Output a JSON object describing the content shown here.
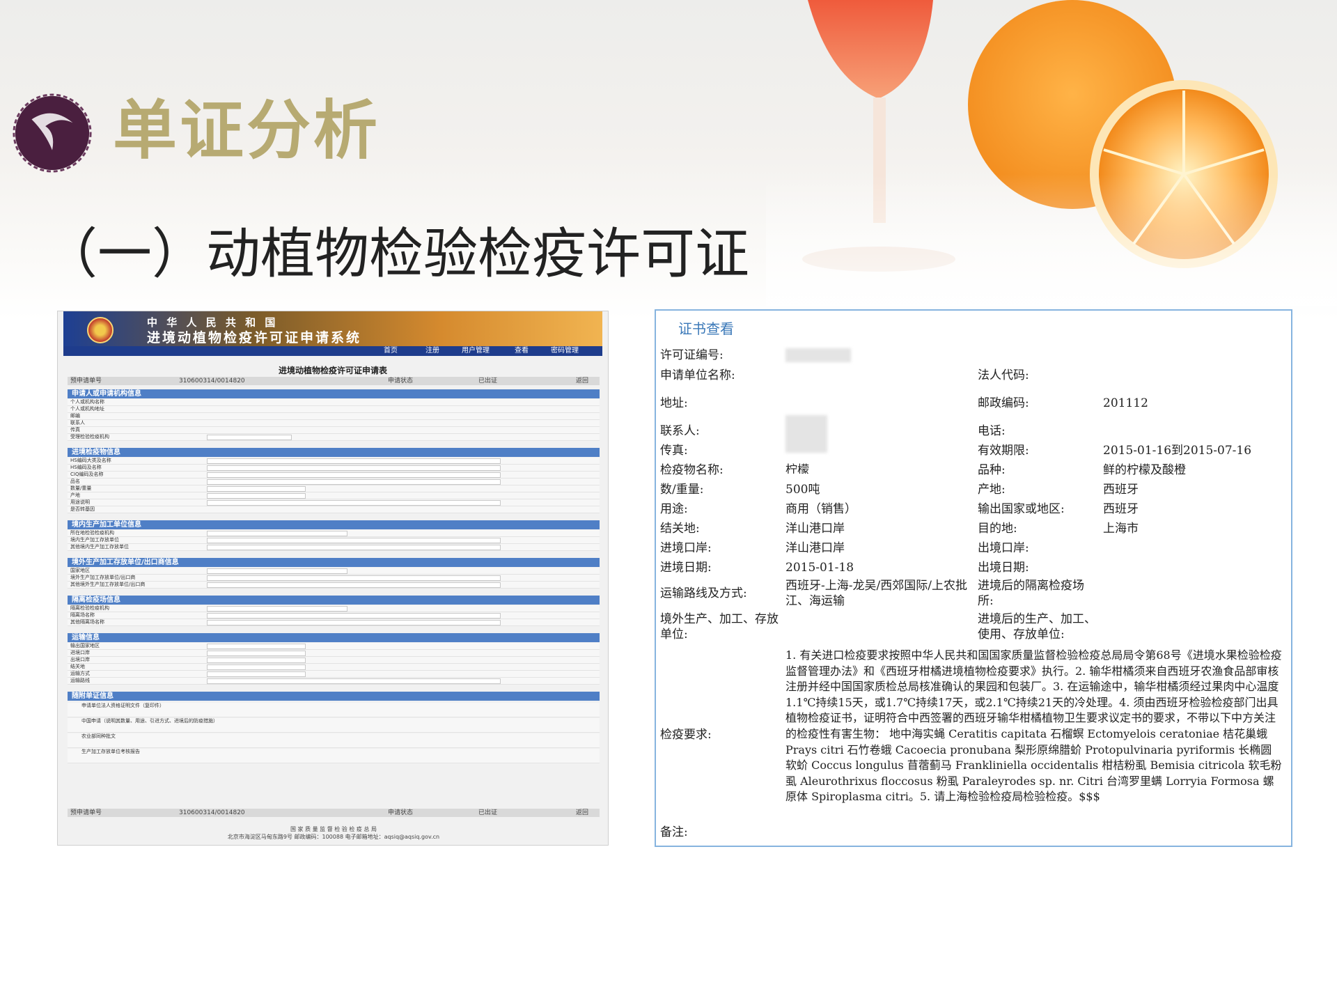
{
  "page": {
    "section_title": "单证分析",
    "subtitle": "（一）动植物检验检疫许可证"
  },
  "app": {
    "title_line1": "中 华 人 民 共 和 国",
    "title_line2": "进境动植物检疫许可证申请系统",
    "nav": [
      "首页",
      "注册",
      "用户管理",
      "查看",
      "密码管理"
    ],
    "form_title": "进境动植物检疫许可证申请表",
    "top_bar": {
      "label": "预申请单号",
      "number": "310600314/0014820",
      "status_label": "申请状态",
      "status": "已出证",
      "button": "返回"
    },
    "sections": [
      {
        "title": "申请人或申请机构信息",
        "rows": [
          "个人或机构名称",
          "个人或机构地址",
          "邮编",
          "联系人",
          "传真",
          "受理检验检疫机构"
        ]
      },
      {
        "title": "进境检疫物信息",
        "rows": [
          "HS编码大类及名称",
          "HS编码及名称",
          "CIQ编码及名称",
          "品名",
          "数量/重量",
          "产地",
          "用途说明",
          "是否转基因"
        ]
      },
      {
        "title": "境内生产加工单位信息",
        "rows": [
          "所在地检验检疫机构",
          "境内生产加工存放单位",
          "其他境内生产加工存放单位"
        ]
      },
      {
        "title": "境外生产加工存放单位/出口商信息",
        "rows": [
          "国家地区",
          "境外生产加工存放单位/出口商",
          "其他境外生产加工存放单位/出口商"
        ]
      },
      {
        "title": "隔离检疫场信息",
        "rows": [
          "隔离检验检疫机构",
          "隔离场名称",
          "其他隔离场名称"
        ]
      },
      {
        "title": "运输信息",
        "rows": [
          "输出国家地区",
          "进境口岸",
          "出境口岸",
          "结关地",
          "运输方式",
          "运输路线"
        ]
      },
      {
        "title": "随附单证信息",
        "rows": [
          "申请单位法人资格证明文件（复印件）",
          "中国申请（说明其数量、用途、引进方式、进境后的防疫措施）",
          "农业部同种批文",
          "生产加工存放单位考核报告"
        ]
      }
    ],
    "bottom_bar": {
      "label": "预申请单号",
      "number": "310600314/0014820",
      "status_label": "申请状态",
      "status": "已出证",
      "button": "返回"
    },
    "footer_line1": "国 家 质 量 监 督 检 验 检 疫 总 局",
    "footer_line2": "北京市海淀区马甸东路9号  邮政编码：100088  电子邮箱地址：aqsiq@aqsiq.gov.cn"
  },
  "cert": {
    "heading": "证书查看",
    "left_fields": [
      {
        "label": "许可证编号:",
        "value": ""
      },
      {
        "label": "申请单位名称:",
        "value": ""
      },
      {
        "label": "地址:",
        "value": ""
      },
      {
        "label": "联系人:",
        "value": ""
      },
      {
        "label": "传真:",
        "value": ""
      },
      {
        "label": "检疫物名称:",
        "value": "柠檬"
      },
      {
        "label": "数/重量:",
        "value": "500吨"
      },
      {
        "label": "用途:",
        "value": "商用（销售）"
      },
      {
        "label": "结关地:",
        "value": "洋山港口岸"
      },
      {
        "label": "进境口岸:",
        "value": "洋山港口岸"
      },
      {
        "label": "进境日期:",
        "value": "2015-01-18"
      },
      {
        "label": "运输路线及方式:",
        "value": "西班牙-上海-龙吴/西郊国际/上农批江、海运输"
      },
      {
        "label": "境外生产、加工、存放单位:",
        "value": ""
      }
    ],
    "right_fields": [
      {
        "label": "法人代码:",
        "value": ""
      },
      {
        "label": "邮政编码:",
        "value": "201112"
      },
      {
        "label": "电话:",
        "value": ""
      },
      {
        "label": "有效期限:",
        "value": "2015-01-16到2015-07-16"
      },
      {
        "label": "品种:",
        "value": "鲜的柠檬及酸橙"
      },
      {
        "label": "产地:",
        "value": "西班牙"
      },
      {
        "label": "输出国家或地区:",
        "value": "西班牙"
      },
      {
        "label": "目的地:",
        "value": "上海市"
      },
      {
        "label": "出境口岸:",
        "value": ""
      },
      {
        "label": "出境日期:",
        "value": ""
      },
      {
        "label": "进境后的隔离检疫场所:",
        "value": ""
      },
      {
        "label": "进境后的生产、加工、使用、存放单位:",
        "value": ""
      }
    ],
    "requirements_label": "检疫要求:",
    "requirements_text": "1. 有关进口检疫要求按照中华人民共和国国家质量监督检验检疫总局局令第68号《进境水果检验检疫监督管理办法》和《西班牙柑橘进境植物检疫要求》执行。2. 输华柑橘须来自西班牙农渔食品部审核注册并经中国国家质检总局核准确认的果园和包装厂。3. 在运输途中，输华柑橘须经过果肉中心温度1.1℃持续15天，或1.7℃持续17天，或2.1℃持续21天的冷处理。4. 须由西班牙检验检疫部门出具植物检疫证书，证明符合中西签署的西班牙输华柑橘植物卫生要求议定书的要求，不带以下中方关注的检疫性有害生物： 地中海实蝇 Ceratitis capitata 石榴螟 Ectomyelois ceratoniae 桔花巢蛾 Prays citri 石竹卷蛾 Cacoecia pronubana 梨形原绵腊蚧 Protopulvinaria pyriformis 长椭圆软蚧 Coccus longulus 苜蓿蓟马 Frankliniella occidentalis 柑桔粉虱 Bemisia citricola 软毛粉虱 Aleurothrixus floccosus 粉虱 Paraleyrodes sp. nr. Citri 台湾罗里螨 Lorryia Formosa 螺原体 Spiroplasma citri。5. 请上海检验检疫局检验检疫。$$$",
    "remarks_label": "备注:"
  },
  "colors": {
    "title_gold": "#b7aa72",
    "cert_border": "#86b4df",
    "form_blue": "#4f7fc6"
  }
}
